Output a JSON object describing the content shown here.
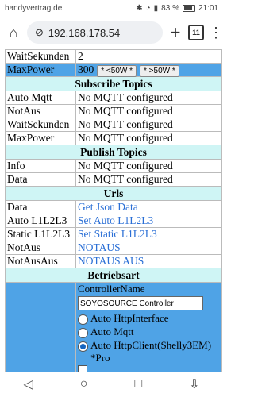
{
  "status_bar": {
    "app": "handyvertrag.de",
    "battery": "83 %",
    "time": "21:01"
  },
  "browser": {
    "url": "192.168.178.54",
    "tab_count": "11"
  },
  "top_rows": [
    {
      "key": "WaitSekunden",
      "value": "2"
    },
    {
      "key": "MaxPower",
      "value": "300",
      "btn_minus": "* <50W *",
      "btn_plus": "* >50W *"
    }
  ],
  "subscribe": {
    "title": "Subscribe Topics",
    "rows": [
      {
        "key": "Auto Mqtt",
        "value": "No MQTT configured"
      },
      {
        "key": "NotAus",
        "value": "No MQTT configured"
      },
      {
        "key": "WaitSekunden",
        "value": "No MQTT configured"
      },
      {
        "key": "MaxPower",
        "value": "No MQTT configured"
      }
    ]
  },
  "publish": {
    "title": "Publish Topics",
    "rows": [
      {
        "key": "Info",
        "value": "No MQTT configured"
      },
      {
        "key": "Data",
        "value": "No MQTT configured"
      }
    ]
  },
  "urls": {
    "title": "Urls",
    "rows": [
      {
        "key": "Data",
        "link": "Get Json Data"
      },
      {
        "key": "Auto L1L2L3",
        "link": "Set Auto L1L2L3"
      },
      {
        "key": "Static L1L2L3",
        "link": "Set Static L1L2L3"
      },
      {
        "key": "NotAus",
        "link": "NOTAUS"
      },
      {
        "key": "NotAusAus",
        "link": "NOTAUS AUS"
      }
    ]
  },
  "betriebsart": {
    "title": "Betriebsart",
    "controller_label": "ControllerName",
    "controller_value": "SOYOSOURCE Controller",
    "options": [
      "Auto HttpInterface",
      "Auto Mqtt",
      "Auto HttpClient(Shelly3EM) *Pro"
    ],
    "selected_index": 2
  }
}
